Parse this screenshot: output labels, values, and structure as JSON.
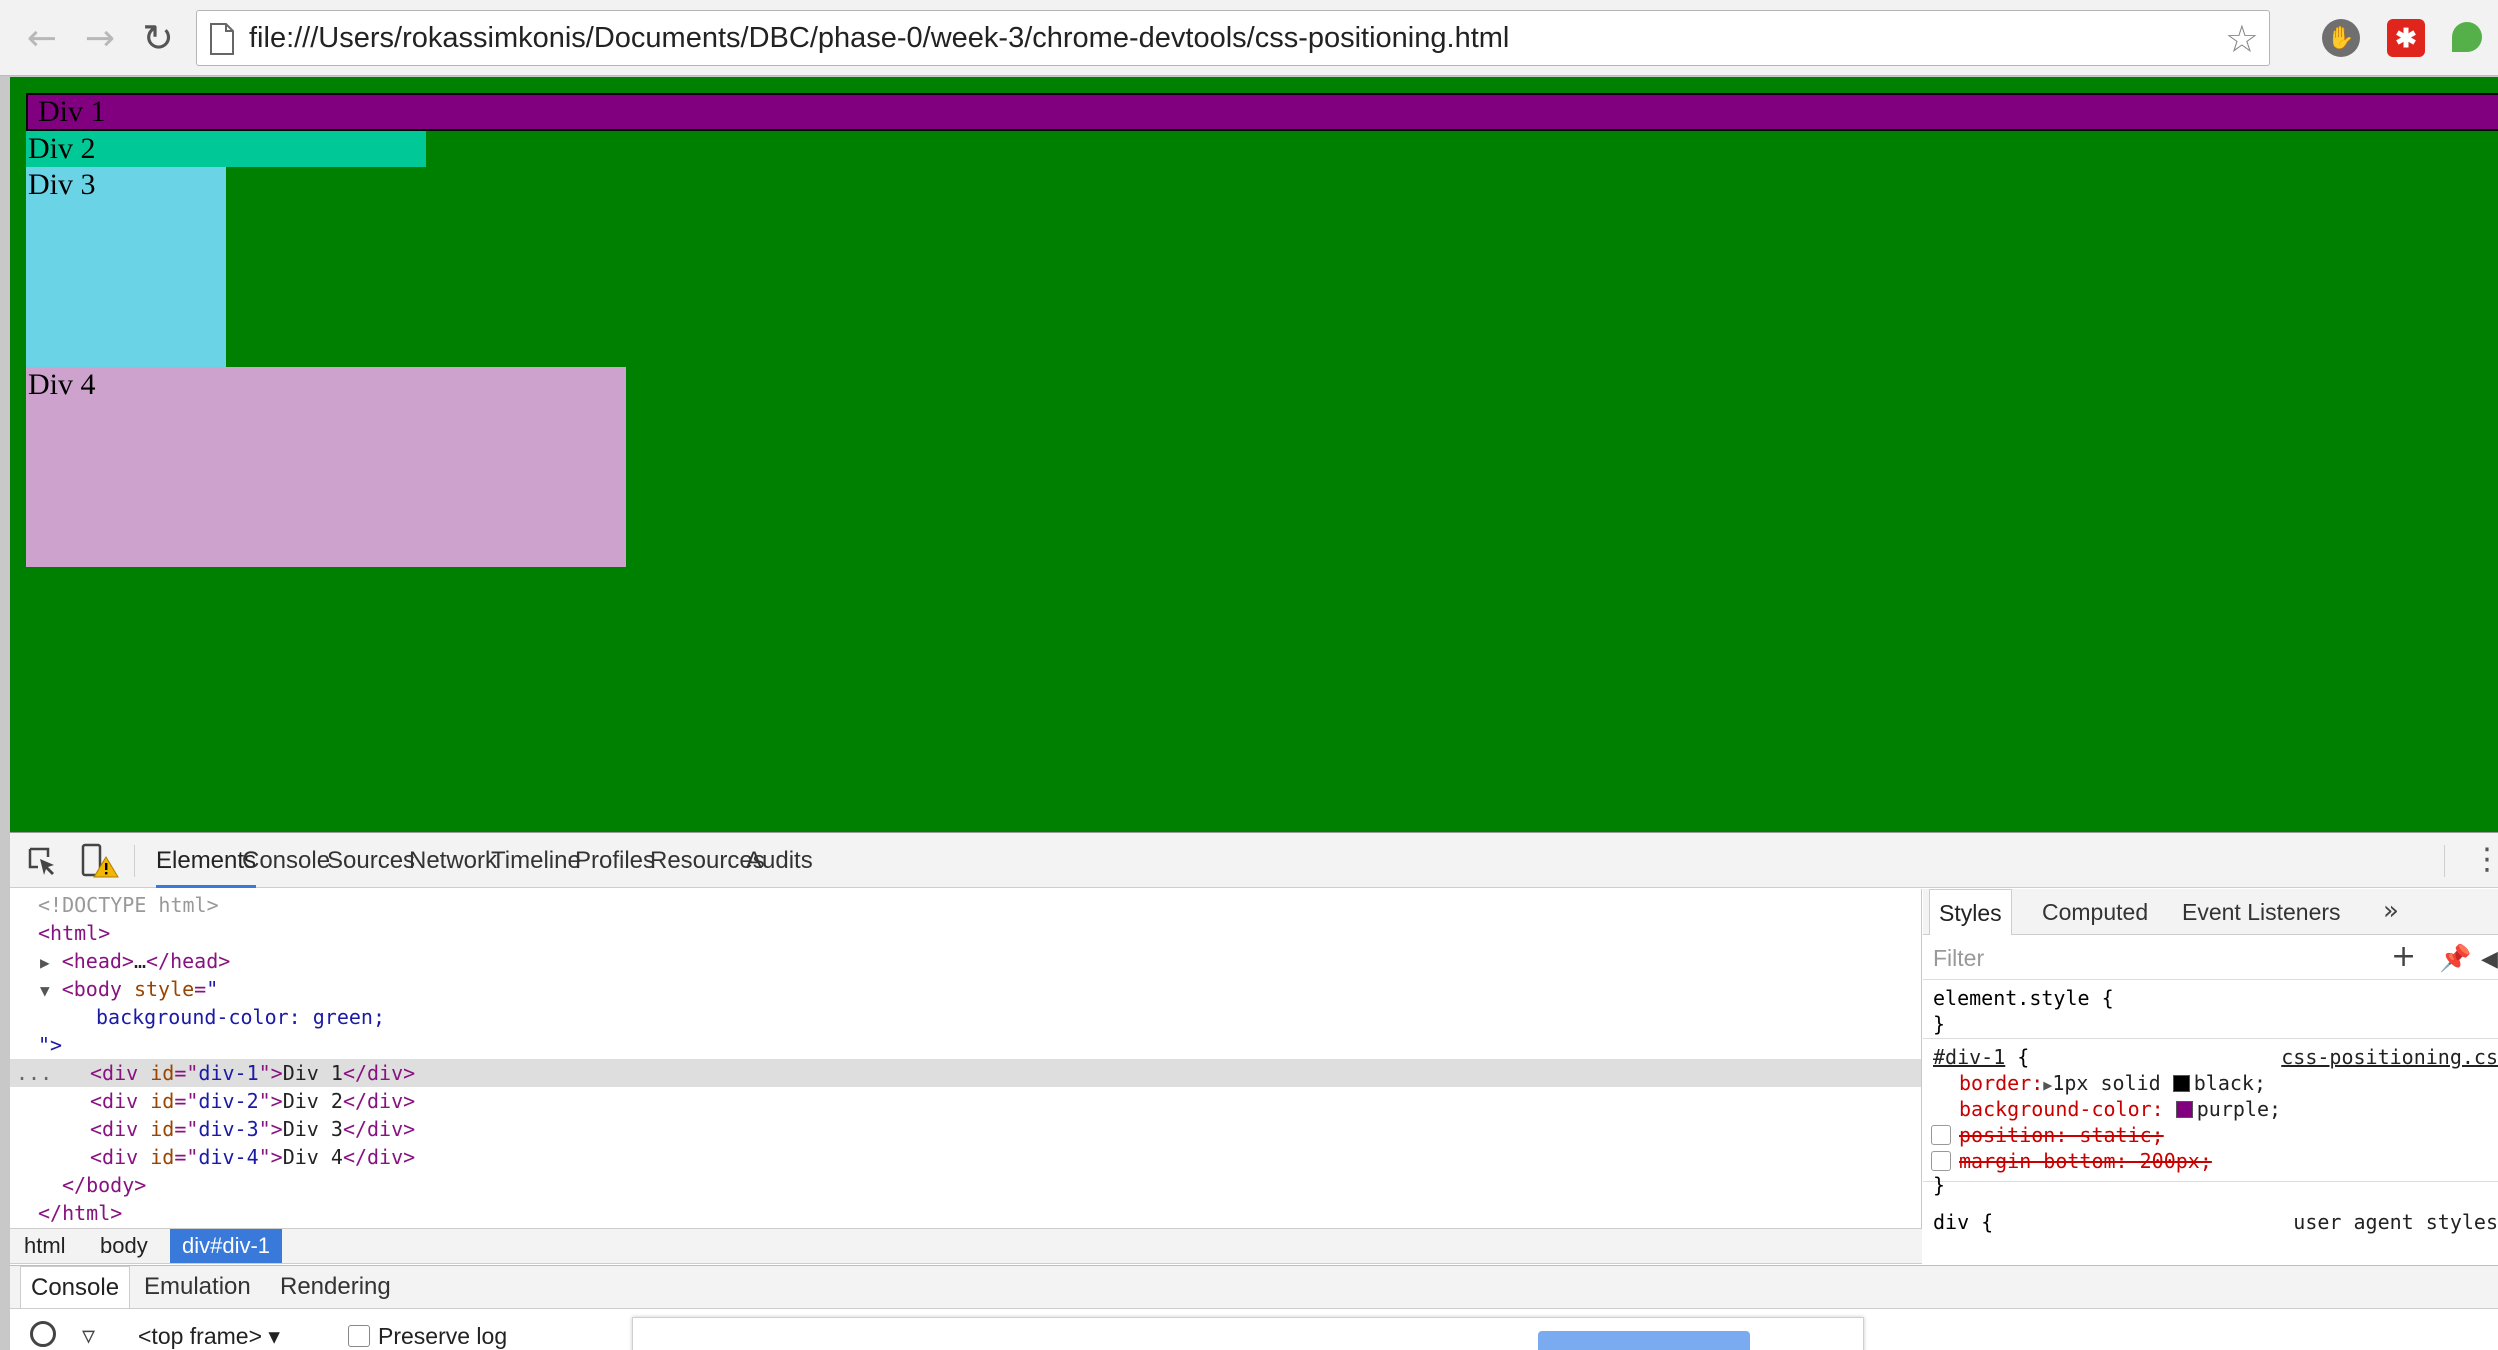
{
  "browser": {
    "url": "file:///Users/rokassimkonis/Documents/DBC/phase-0/week-3/chrome-devtools/css-positioning.html"
  },
  "page": {
    "divs": [
      "Div 1",
      "Div 2",
      "Div 3",
      "Div 4"
    ],
    "colors": {
      "body": "#008000",
      "div1": "#800080",
      "div2": "#00c896",
      "div3": "#6ad4e6",
      "div4": "#cda2cd"
    }
  },
  "devtools": {
    "tabs": [
      "Elements",
      "Console",
      "Sources",
      "Network",
      "Timeline",
      "Profiles",
      "Resources",
      "Audits"
    ],
    "active_tab": "Elements",
    "tree": {
      "doctype": "<!DOCTYPE html>",
      "html_open": "html",
      "head_open": "head",
      "head_ellipsis": "…",
      "head_close": "/head",
      "body_open": "body",
      "style_attr": "style",
      "style_quote": "\"",
      "style_value": "background-color: green;",
      "style_close": "\">",
      "divs": [
        {
          "id": "div-1",
          "text": "Div 1"
        },
        {
          "id": "div-2",
          "text": "Div 2"
        },
        {
          "id": "div-3",
          "text": "Div 3"
        },
        {
          "id": "div-4",
          "text": "Div 4"
        }
      ],
      "body_close": "/body",
      "html_close": "/html",
      "selected_marker": "..."
    },
    "breadcrumbs": [
      "html",
      "body",
      "div#div-1"
    ],
    "styles_tabs": [
      "Styles",
      "Computed",
      "Event Listeners"
    ],
    "styles_more": "»",
    "filter_placeholder": "Filter",
    "element_style": "element.style {",
    "close_brace": "}",
    "rule": {
      "selector": "#div-1",
      "open_brace": "{",
      "source": "css-positioning.cs",
      "props": [
        {
          "name": "border:",
          "value": "1px solid",
          "color_name": "black;",
          "swatch": "#000000"
        },
        {
          "name": "background-color:",
          "value": "",
          "color_name": "purple;",
          "swatch": "#800080"
        },
        {
          "struck": "position: static;"
        },
        {
          "struck": "margin-bottom: 200px;"
        }
      ]
    },
    "ua_rule": {
      "selector": "div {",
      "source": "user agent styles"
    },
    "drawer_tabs": [
      "Console",
      "Emulation",
      "Rendering"
    ],
    "console": {
      "frame": "<top frame>",
      "preserve_log": "Preserve log"
    }
  }
}
